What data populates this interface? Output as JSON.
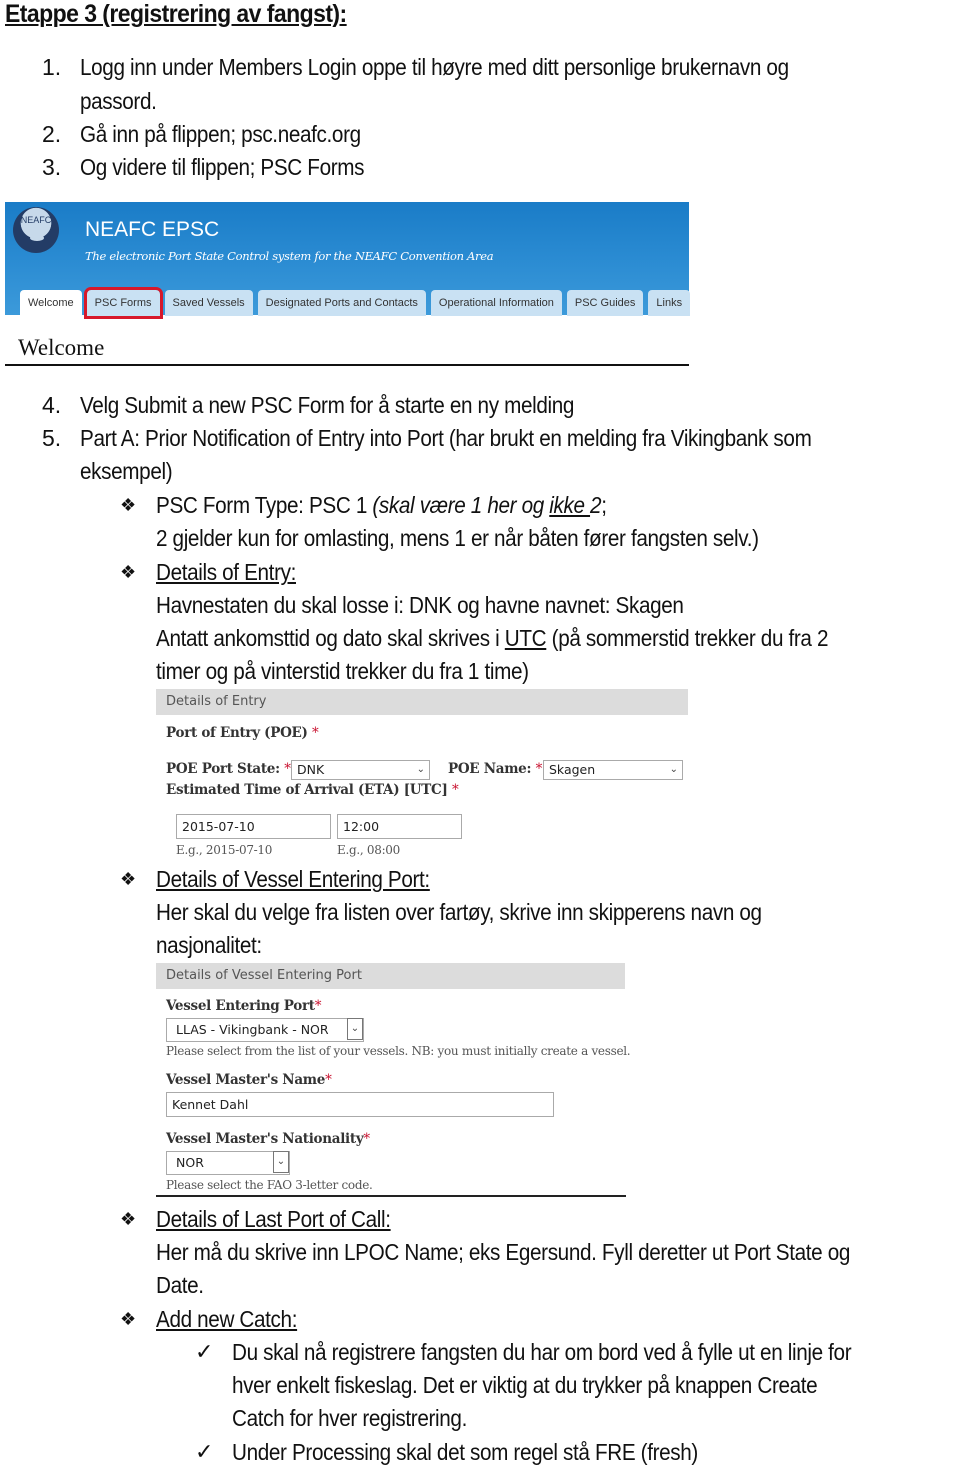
{
  "heading": "Etappe 3 (registrering av fangst):",
  "steps": [
    {
      "num": "1.",
      "lines": [
        "Logg inn under Members Login oppe til høyre med ditt personlige brukernavn og",
        "passord."
      ]
    },
    {
      "num": "2.",
      "lines": [
        "Gå inn på flippen; psc.neafc.org"
      ]
    },
    {
      "num": "3.",
      "lines": [
        "Og videre til flippen; PSC Forms"
      ]
    },
    {
      "num": "4.",
      "lines": [
        "Velg Submit a new PSC Form for å starte en ny melding"
      ]
    },
    {
      "num": "5.",
      "lines": [
        "Part A: Prior Notification of Entry into Port (har brukt en melding fra Vikingbank som",
        "eksempel)"
      ]
    }
  ],
  "neafc": {
    "logo_text": "NEAFC",
    "title": "NEAFC EPSC",
    "subtitle": "The electronic Port State Control system for the NEAFC Convention Area",
    "tabs": [
      {
        "label": "Welcome",
        "state": "active"
      },
      {
        "label": "PSC Forms",
        "state": "highlighted"
      },
      {
        "label": "Saved Vessels",
        "state": "normal"
      },
      {
        "label": "Designated Ports and Contacts",
        "state": "normal"
      },
      {
        "label": "Operational Information",
        "state": "normal"
      },
      {
        "label": "PSC Guides",
        "state": "normal"
      },
      {
        "label": "Links",
        "state": "normal"
      }
    ],
    "page_heading": "Welcome",
    "highlight_color": "#d7182a"
  },
  "bullets": {
    "form_type": {
      "prefix": "PSC Form Type: PSC 1 ",
      "italic_a": "(skal være 1 her og ",
      "italic_underlined": "ikke ",
      "italic_b": "2",
      "suffix": ";",
      "line2": "2 gjelder kun for omlasting, mens 1 er når båten fører fangsten selv.)"
    },
    "details_entry": {
      "title": "Details of Entry:",
      "line1": "Havnestaten du skal losse i: DNK og havne navnet: Skagen",
      "line2_a": "Antatt ankomsttid og dato skal skrives i ",
      "line2_u": "UTC",
      "line2_b": " (på sommerstid trekker du fra 2",
      "line3": "timer og på vinterstid trekker du fra 1 time)"
    },
    "details_vessel": {
      "title": "Details of Vessel Entering Port:",
      "line1": "Her skal du velge fra listen over fartøy, skrive inn skipperens navn og",
      "line2": "nasjonalitet:"
    },
    "last_port": {
      "title": "Details of Last Port of Call:",
      "line1": "Her må du skrive inn LPOC Name; eks Egersund. Fyll deretter ut Port State og",
      "line2": "Date."
    },
    "add_catch": {
      "title": "Add new Catch:",
      "checks": [
        {
          "lines": [
            "Du skal nå registrere fangsten du har om bord ved å fylle ut en linje for",
            "hver enkelt fiskeslag. Det er viktig at du trykker på knappen Create",
            "Catch for hver registrering."
          ]
        },
        {
          "lines": [
            "Under Processing skal det som regel stå FRE (fresh)"
          ]
        }
      ]
    }
  },
  "entry_form": {
    "header": "Details of Entry",
    "poe_label": "Port of Entry (POE)",
    "required_mark": "*",
    "port_state_label": "POE Port State:",
    "port_state_value": "DNK",
    "poe_name_label": "POE Name:",
    "poe_name_value": "Skagen",
    "eta_label": "Estimated Time of Arrival (ETA) [UTC]",
    "date_value": "2015-07-10",
    "time_value": "12:00",
    "date_hint": "E.g., 2015-07-10",
    "time_hint": "E.g., 08:00"
  },
  "vessel_form": {
    "header": "Details of Vessel Entering Port",
    "vessel_label": "Vessel Entering Port",
    "required_mark": "*",
    "vessel_value": "LLAS - Vikingbank - NOR",
    "vessel_hint": "Please select from the list of your vessels. NB: you must initially create a vessel.",
    "master_name_label": "Vessel Master's Name",
    "master_name_value": "Kennet Dahl",
    "nationality_label": "Vessel Master's Nationality",
    "nationality_value": "NOR",
    "nationality_hint": "Please select the FAO 3-letter code."
  },
  "icons": {
    "bullet": "❖",
    "check": "✓",
    "caret": "⌄"
  }
}
